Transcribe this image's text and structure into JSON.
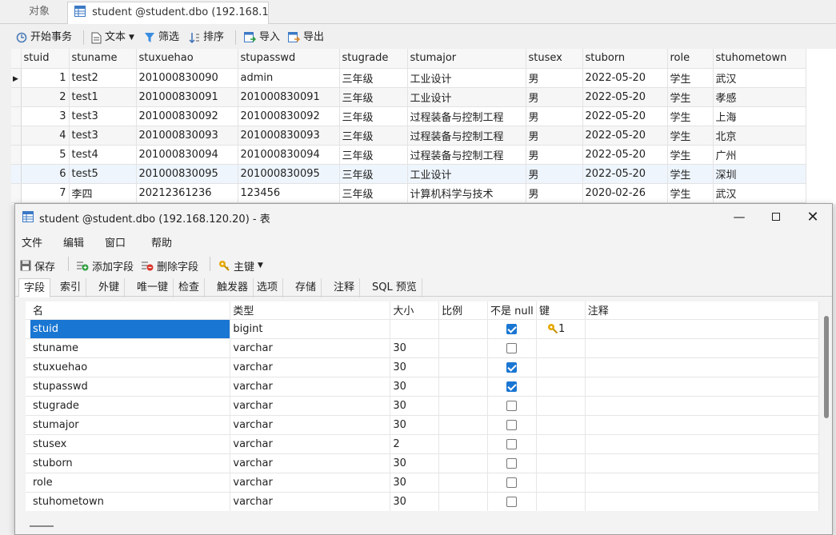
{
  "bg_tabs": {
    "objects": "对象",
    "student": "student @student.dbo (192.168.1..."
  },
  "bg_toolbar": {
    "begin_tx": "开始事务",
    "text": "文本",
    "filter": "筛选",
    "sort": "排序",
    "import": "导入",
    "export": "导出"
  },
  "bg_table": {
    "columns": [
      "stuid",
      "stuname",
      "stuxuehao",
      "stupasswd",
      "stugrade",
      "stumajor",
      "stusex",
      "stuborn",
      "role",
      "stuhometown"
    ],
    "rows": [
      [
        "1",
        "test2",
        "201000830090",
        "admin",
        "三年级",
        "工业设计",
        "男",
        "2022-05-20",
        "学生",
        "武汉"
      ],
      [
        "2",
        "test1",
        "201000830091",
        "201000830091",
        "三年级",
        "工业设计",
        "男",
        "2022-05-20",
        "学生",
        "孝感"
      ],
      [
        "3",
        "test3",
        "201000830092",
        "201000830092",
        "三年级",
        "过程装备与控制工程",
        "男",
        "2022-05-20",
        "学生",
        "上海"
      ],
      [
        "4",
        "test3",
        "201000830093",
        "201000830093",
        "三年级",
        "过程装备与控制工程",
        "男",
        "2022-05-20",
        "学生",
        "北京"
      ],
      [
        "5",
        "test4",
        "201000830094",
        "201000830094",
        "三年级",
        "过程装备与控制工程",
        "男",
        "2022-05-20",
        "学生",
        "广州"
      ],
      [
        "6",
        "test5",
        "201000830095",
        "201000830095",
        "三年级",
        "工业设计",
        "男",
        "2022-05-20",
        "学生",
        "深圳"
      ],
      [
        "7",
        "李四",
        "20212361236",
        "123456",
        "三年级",
        "计算机科学与技术",
        "男",
        "2020-02-26",
        "学生",
        "武汉"
      ]
    ]
  },
  "dialog": {
    "title": "student @student.dbo (192.168.120.20) - 表",
    "menu": [
      "文件",
      "编辑",
      "窗口",
      "帮助"
    ],
    "toolbar": {
      "save": "保存",
      "add_field": "添加字段",
      "delete_field": "删除字段",
      "primary_key": "主键"
    },
    "tabs": [
      "字段",
      "索引",
      "外键",
      "唯一键",
      "检查",
      "触发器",
      "选项",
      "存储",
      "注释",
      "SQL 预览"
    ],
    "field_columns": [
      "名",
      "类型",
      "大小",
      "比例",
      "不是 null",
      "键",
      "注释"
    ],
    "fields": [
      {
        "name": "stuid",
        "type": "bigint",
        "size": "",
        "scale": "",
        "not_null": true,
        "key": "1",
        "comment": ""
      },
      {
        "name": "stuname",
        "type": "varchar",
        "size": "30",
        "scale": "",
        "not_null": false,
        "key": "",
        "comment": ""
      },
      {
        "name": "stuxuehao",
        "type": "varchar",
        "size": "30",
        "scale": "",
        "not_null": true,
        "key": "",
        "comment": ""
      },
      {
        "name": "stupasswd",
        "type": "varchar",
        "size": "30",
        "scale": "",
        "not_null": true,
        "key": "",
        "comment": ""
      },
      {
        "name": "stugrade",
        "type": "varchar",
        "size": "30",
        "scale": "",
        "not_null": false,
        "key": "",
        "comment": ""
      },
      {
        "name": "stumajor",
        "type": "varchar",
        "size": "30",
        "scale": "",
        "not_null": false,
        "key": "",
        "comment": ""
      },
      {
        "name": "stusex",
        "type": "varchar",
        "size": "2",
        "scale": "",
        "not_null": false,
        "key": "",
        "comment": ""
      },
      {
        "name": "stuborn",
        "type": "varchar",
        "size": "30",
        "scale": "",
        "not_null": false,
        "key": "",
        "comment": ""
      },
      {
        "name": "role",
        "type": "varchar",
        "size": "30",
        "scale": "",
        "not_null": false,
        "key": "",
        "comment": ""
      },
      {
        "name": "stuhometown",
        "type": "varchar",
        "size": "30",
        "scale": "",
        "not_null": false,
        "key": "",
        "comment": ""
      }
    ]
  },
  "colors": {
    "selection": "#1976d2",
    "accent": "#1976d2",
    "key_icon": "#e6a800"
  }
}
